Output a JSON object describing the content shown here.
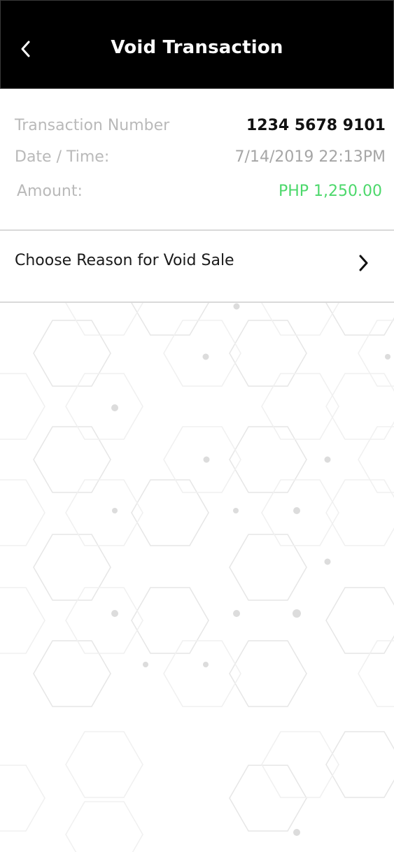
{
  "header": {
    "title": "Void Transaction",
    "back_icon": "chevron-left-icon",
    "background": "#000000"
  },
  "details": {
    "transaction_number_label": "Transaction Number",
    "transaction_number_value": "1234 5678 9101",
    "datetime_label": "Date / Time:",
    "datetime_value": "7/14/2019 22:13PM",
    "amount_label": "Amount:",
    "amount_value": "PHP 1,250.00",
    "amount_color": "#4cd86b"
  },
  "reason": {
    "label": "Choose Reason for Void Sale",
    "icon": "chevron-right-icon"
  }
}
